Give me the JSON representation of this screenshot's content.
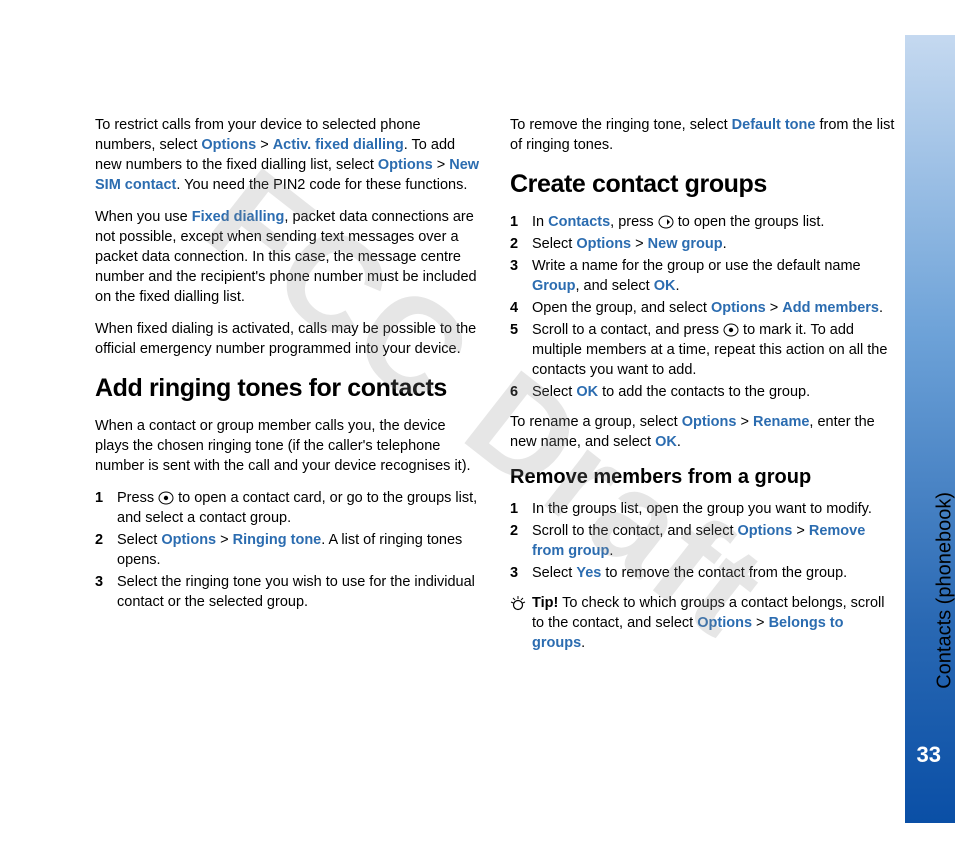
{
  "watermark": "FCC Draft",
  "sidebar": {
    "label": "Contacts (phonebook)",
    "page_num": "33"
  },
  "left": {
    "p1": {
      "t1": "To restrict calls from your device to selected phone numbers, select ",
      "options1": "Options",
      "gt": " > ",
      "activ": "Activ. fixed dialling",
      "t2": ". To add new numbers to the fixed dialling list, select ",
      "options2": "Options",
      "newsim": "New SIM contact",
      "t3": ". You need the PIN2 code for these functions."
    },
    "p2": {
      "t1": "When you use ",
      "fixed": "Fixed dialling",
      "t2": ", packet data connections are not possible, except when sending text messages over a packet data connection. In this case, the message centre number and the recipient's phone number must be included on the fixed dialling list."
    },
    "p3": "When fixed dialing is activated, calls may be possible to the official emergency number programmed into your device.",
    "h2": "Add ringing tones for contacts",
    "p4": "When a contact or group member calls you, the device plays the chosen ringing tone (if the caller's telephone number is sent with the call and your device recognises it).",
    "list": {
      "n1": "1",
      "i1a": "Press ",
      "i1b": " to open a contact card, or go to the groups list, and select a contact group.",
      "n2": "2",
      "i2a": "Select ",
      "i2opts": "Options",
      "i2gt": " > ",
      "i2rt": "Ringing tone",
      "i2b": ". A list of ringing tones opens.",
      "n3": "3",
      "i3": "Select the ringing tone you wish to use for the individual contact or the selected group."
    }
  },
  "right": {
    "p1": {
      "t1": "To remove the ringing tone, select ",
      "def": "Default tone",
      "t2": " from the list of ringing tones."
    },
    "h2": "Create contact groups",
    "list1": {
      "n1": "1",
      "i1a": "In ",
      "i1c": "Contacts",
      "i1b": ", press ",
      "i1d": " to open the groups list.",
      "n2": "2",
      "i2a": "Select ",
      "i2o": "Options",
      "i2gt": " > ",
      "i2ng": "New group",
      "i2dot": ".",
      "n3": "3",
      "i3a": "Write a name for the group or use the default name ",
      "i3g": "Group",
      "i3b": ", and select ",
      "i3ok": "OK",
      "i3dot": ".",
      "n4": "4",
      "i4a": "Open the group, and select ",
      "i4o": "Options",
      "i4gt": " > ",
      "i4am": "Add members",
      "i4dot": ".",
      "n5": "5",
      "i5a": "Scroll to a contact, and press ",
      "i5b": " to mark it. To add multiple members at a time, repeat this action on all the contacts you want to add.",
      "n6": "6",
      "i6a": "Select ",
      "i6ok": "OK",
      "i6b": " to add the contacts to the group."
    },
    "p2": {
      "t1": "To rename a group, select ",
      "o": "Options",
      "gt": " > ",
      "r": "Rename",
      "t2": ", enter the new name, and select ",
      "ok": "OK",
      "dot": "."
    },
    "h3": "Remove members from a group",
    "list2": {
      "n1": "1",
      "i1": "In the groups list, open the group you want to modify.",
      "n2": "2",
      "i2a": "Scroll to the contact, and select ",
      "i2o": "Options",
      "i2gt": " > ",
      "i2rm": "Remove from group",
      "i2dot": ".",
      "n3": "3",
      "i3a": "Select ",
      "i3y": "Yes",
      "i3b": " to remove the contact from the group."
    },
    "tip": {
      "label": "Tip!",
      "t1": " To check to which groups a contact belongs, scroll to the contact, and select ",
      "o": "Options",
      "gt": " > ",
      "bg": "Belongs to groups",
      "dot": "."
    }
  }
}
